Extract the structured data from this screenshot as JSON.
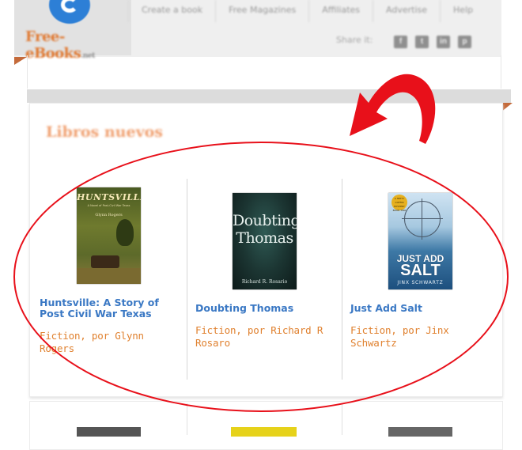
{
  "site": {
    "logo_text": "Free-eBooks",
    "logo_tld": ".net"
  },
  "nav": {
    "items": [
      "Create a book",
      "Free Magazines",
      "Affiliates",
      "Advertise",
      "Help"
    ]
  },
  "share": {
    "label": "Share it:",
    "icons": [
      {
        "name": "facebook-icon",
        "glyph": "f"
      },
      {
        "name": "twitter-icon",
        "glyph": "t"
      },
      {
        "name": "linkedin-icon",
        "glyph": "in"
      },
      {
        "name": "pinterest-icon",
        "glyph": "p"
      }
    ]
  },
  "section": {
    "title": "Libros nuevos"
  },
  "books": [
    {
      "title": "Huntsville: A Story of Post Civil War Texas",
      "meta": "Fiction, por Glynn Rogers",
      "cover": {
        "title": "HUNTSVILLE",
        "subtitle": "A Novel of Post-Civil War Texas",
        "author": "Glynn Rogers"
      }
    },
    {
      "title": "Doubting Thomas",
      "meta": "Fiction, por Richard R Rosaro",
      "cover": {
        "title_line1": "Doubting",
        "title_line2": "Thomas",
        "author": "Richard R. Rosario"
      }
    },
    {
      "title": "Just Add Salt",
      "meta": "Fiction, por Jinx Schwartz",
      "cover": {
        "badge": "A HETTY COFFIN MYSTERY BOOK TWO",
        "title_line1": "JUST ADD",
        "title_line2": "SALT",
        "author": "JINX SCHWARTZ"
      }
    }
  ],
  "colors": {
    "link": "#3a78c4",
    "meta": "#e0812f",
    "annotation": "#e8101a",
    "section_title": "#f0a070"
  }
}
